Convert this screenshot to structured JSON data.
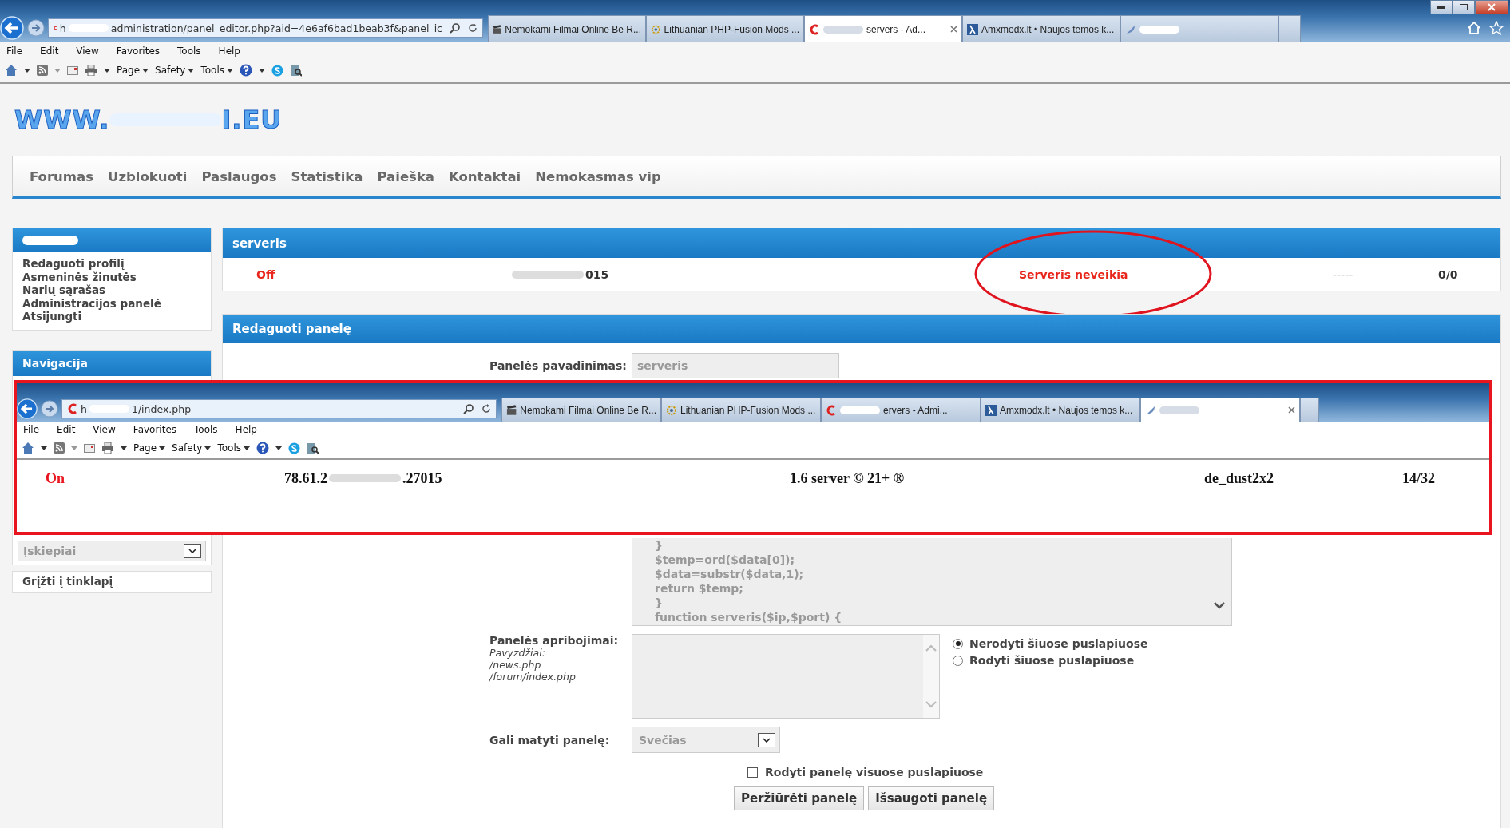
{
  "browser": {
    "address_start": "h",
    "address": "administration/panel_editor.php?aid=4e6af6bad1beab3f&panel_ic",
    "tabs": [
      {
        "kind": "clapper",
        "title": "Nemokami Filmai Online Be R...",
        "selected": false,
        "redacted": false
      },
      {
        "kind": "gear",
        "title": "Lithuanian PHP-Fusion Mods ...",
        "selected": false,
        "redacted": false
      },
      {
        "kind": "c",
        "title": "servers - Ad...",
        "selected": true,
        "redacted": true
      },
      {
        "kind": "lambda",
        "title": "Amxmodx.lt • Naujos temos k...",
        "selected": false,
        "redacted": false
      },
      {
        "kind": "feather",
        "selected": false,
        "redacted": true
      }
    ],
    "menu": [
      "File",
      "Edit",
      "View",
      "Favorites",
      "Tools",
      "Help"
    ],
    "commands": [
      "Page",
      "Safety",
      "Tools"
    ]
  },
  "site": {
    "logo_start": "WWW.",
    "logo_end": "I.EU",
    "nav": [
      "Forumas",
      "Uzblokuoti",
      "Paslaugos",
      "Statistika",
      "Paieška",
      "Kontaktai",
      "Nemokasmas vip"
    ]
  },
  "sidebar": {
    "user_items": [
      "Redaguoti profilį",
      "Asmeninės žinutės",
      "Narių sąrašas",
      "Administracijos panelė",
      "Atsijungti"
    ],
    "navigation_title": "Navigacija",
    "select_value": "Įskiepiai",
    "back_link": "Grįžti į tinklapį"
  },
  "server_panel": {
    "title": "serveris",
    "status": "Off",
    "address": "015",
    "name": "Serveris neveikia",
    "map": "-----",
    "players": "0/0"
  },
  "edit_panel": {
    "title": "Redaguoti panelę",
    "name_label": "Panelės pavadinimas:",
    "name_value": "serveris",
    "code_lines": [
      "}",
      "$temp=ord($data[0]);",
      "$data=substr($data,1);",
      "return $temp;",
      "}",
      "function serveris($ip,$port) {"
    ],
    "restrictions_label": "Panelės apribojimai:",
    "restrictions_hint": [
      "Pavyzdžiai:",
      "/news.php",
      "/forum/index.php"
    ],
    "visibility_options": [
      {
        "label": "Nerodyti šiuose puslapiuose",
        "selected": true
      },
      {
        "label": "Rodyti šiuose puslapiuose",
        "selected": false
      }
    ],
    "access_label": "Gali matyti panelę:",
    "access_value": "Svečias",
    "show_all": {
      "label": "Rodyti panelę visuose puslapiuose",
      "checked": false
    },
    "buttons": [
      "Peržiūrėti panelę",
      "Išsaugoti panelę"
    ]
  },
  "inset": {
    "browser": {
      "address_start": "h",
      "address": "1/index.php",
      "tabs": [
        {
          "kind": "clapper",
          "title": "Nemokami Filmai Online Be R...",
          "selected": false,
          "redacted": false
        },
        {
          "kind": "gear",
          "title": "Lithuanian PHP-Fusion Mods ...",
          "selected": false,
          "redacted": false
        },
        {
          "kind": "c",
          "title": "ervers - Admi...",
          "selected": false,
          "redacted": true
        },
        {
          "kind": "lambda",
          "title": "Amxmodx.lt • Naujos temos k...",
          "selected": false,
          "redacted": false
        },
        {
          "kind": "feather",
          "selected": true,
          "redacted": true
        }
      ],
      "menu": [
        "File",
        "Edit",
        "View",
        "Favorites",
        "Tools",
        "Help"
      ],
      "commands": [
        "Page",
        "Safety",
        "Tools"
      ]
    },
    "row": {
      "status": "On",
      "address_start": "78.61.2",
      "address_end": ".27015",
      "name": "1.6 server © 21+ ®",
      "map": "de_dust2x2",
      "players": "14/32"
    }
  }
}
